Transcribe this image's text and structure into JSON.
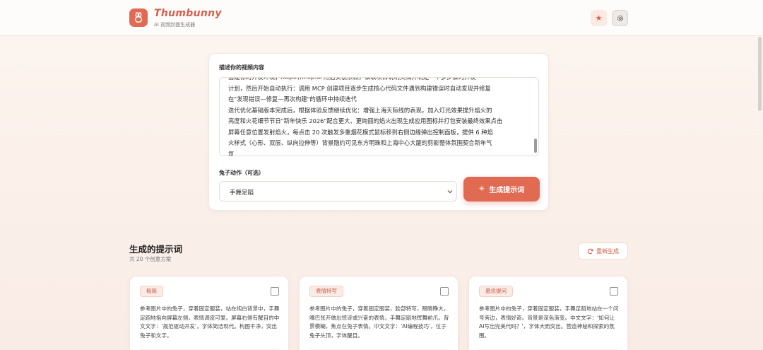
{
  "header": {
    "app_name": "Thumbunny",
    "app_subtitle": "AI 视频封面生成器",
    "icons": [
      "rabbit-logo-icon",
      "star-icon",
      "gear-icon"
    ]
  },
  "form": {
    "description_label": "描述你的视频内容",
    "description_value": "搭建你的开发环境，https://mcp.ai 然后安装依赖，读取项目说明文档并制定一个多步骤的开发\n计划，然后开始自动执行：调用 MCP 创建项目逐步生成核心代码文件遇到构建错误时自动发现并修复\n在\"发现错误—修复—再次构建\"的循环中持续迭代\n迭代优化基础版本完成后，根据体验反馈继续优化：增强上海天际线的表现，加入灯光效果提升焰火的\n亮度和火花细节节日\"新年快乐 2026\"配合更大、更绚丽的焰火出现生成应用图标并打包安装最终效果点击\n屏幕任意位置发射焰火，每点击 20 次触发多重烟花模式鼠标移到右侧边缘弹出控制面板，提供 6 种焰\n火样式（心形、双层、纵向拉伸等）背景隐约可见东方明珠和上海中心大厦的剪影整体氛围契合新年气\n氛",
    "action_label": "兔子动作（可选）",
    "action_value": "手舞足蹈",
    "generate_label": "生成提示词"
  },
  "results": {
    "title": "生成的提示词",
    "count_text": "共 20 个创意方案",
    "regenerate_label": "重新生成",
    "cards": [
      {
        "tag": "极简",
        "text": "参考图片中的兔子，穿着固定服装，站在纯白背景中，手舞足蹈地指向屏幕左侧，表情调皮可爱。屏幕右侧有醒目的中文文字：'规范驱动开发'，字体简洁现代。构图干净，突出兔子和文字。"
      },
      {
        "tag": "表情特写",
        "text": "参考图片中的兔子，穿着固定服装，脸部特写，眼睛睁大，嘴巴张开做出惊讶或兴奋的表情，手舞足蹈地挥舞前爪。背景模糊，焦点在兔子表情。中文文字：'AI编程技巧'，位于兔子头顶，字体醒目。"
      },
      {
        "tag": "悬念提问",
        "text": "参考图片中的兔子，穿着固定服装，手舞足蹈地站在一个问号旁边，表情好奇。背景是深色渐变。中文文字：'如何让AI写出完美代码？'，字体大而突出。营造神秘和探索的氛围。"
      }
    ]
  },
  "colors": {
    "accent": "#e06a52",
    "tag_bg": "#fcebe5"
  }
}
